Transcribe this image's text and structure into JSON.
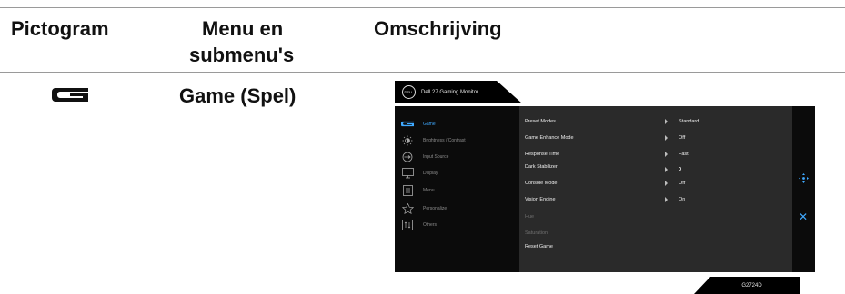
{
  "table_headers": {
    "col1": "Pictogram",
    "col2_line1": "Menu en",
    "col2_line2": "submenu's",
    "col3": "Omschrijving"
  },
  "row": {
    "menu_name": "Game (Spel)",
    "icon": "game-icon"
  },
  "osd": {
    "monitor_title": "Dell 27 Gaming Monitor",
    "logo_text": "DELL",
    "accent_color": "#3fa9ff",
    "menu": [
      {
        "label": "Game",
        "icon": "game-icon",
        "active": true
      },
      {
        "label": "Brightness / Contrast",
        "icon": "brightness-icon",
        "active": false
      },
      {
        "label": "Input Source",
        "icon": "input-source-icon",
        "active": false
      },
      {
        "label": "Display",
        "icon": "display-icon",
        "active": false
      },
      {
        "label": "Menu",
        "icon": "menu-icon",
        "active": false
      },
      {
        "label": "Personalize",
        "icon": "star-icon",
        "active": false
      },
      {
        "label": "Others",
        "icon": "others-icon",
        "active": false
      }
    ],
    "options": [
      {
        "label": "Preset Modes",
        "value": "Standard",
        "enabled": true
      },
      {
        "label": "Game Enhance Mode",
        "value": "Off",
        "enabled": true
      },
      {
        "label": "Response Time",
        "value": "Fast",
        "enabled": true
      },
      {
        "label": "Dark Stabilizer",
        "value": "0",
        "enabled": true
      },
      {
        "label": "Console Mode",
        "value": "Off",
        "enabled": true
      },
      {
        "label": "Vision Engine",
        "value": "On",
        "enabled": true
      },
      {
        "label": "Hue",
        "value": "",
        "enabled": false
      },
      {
        "label": "Saturation",
        "value": "",
        "enabled": false
      },
      {
        "label": "Reset Game",
        "value": "",
        "enabled": true
      }
    ],
    "model": "G2724D"
  }
}
